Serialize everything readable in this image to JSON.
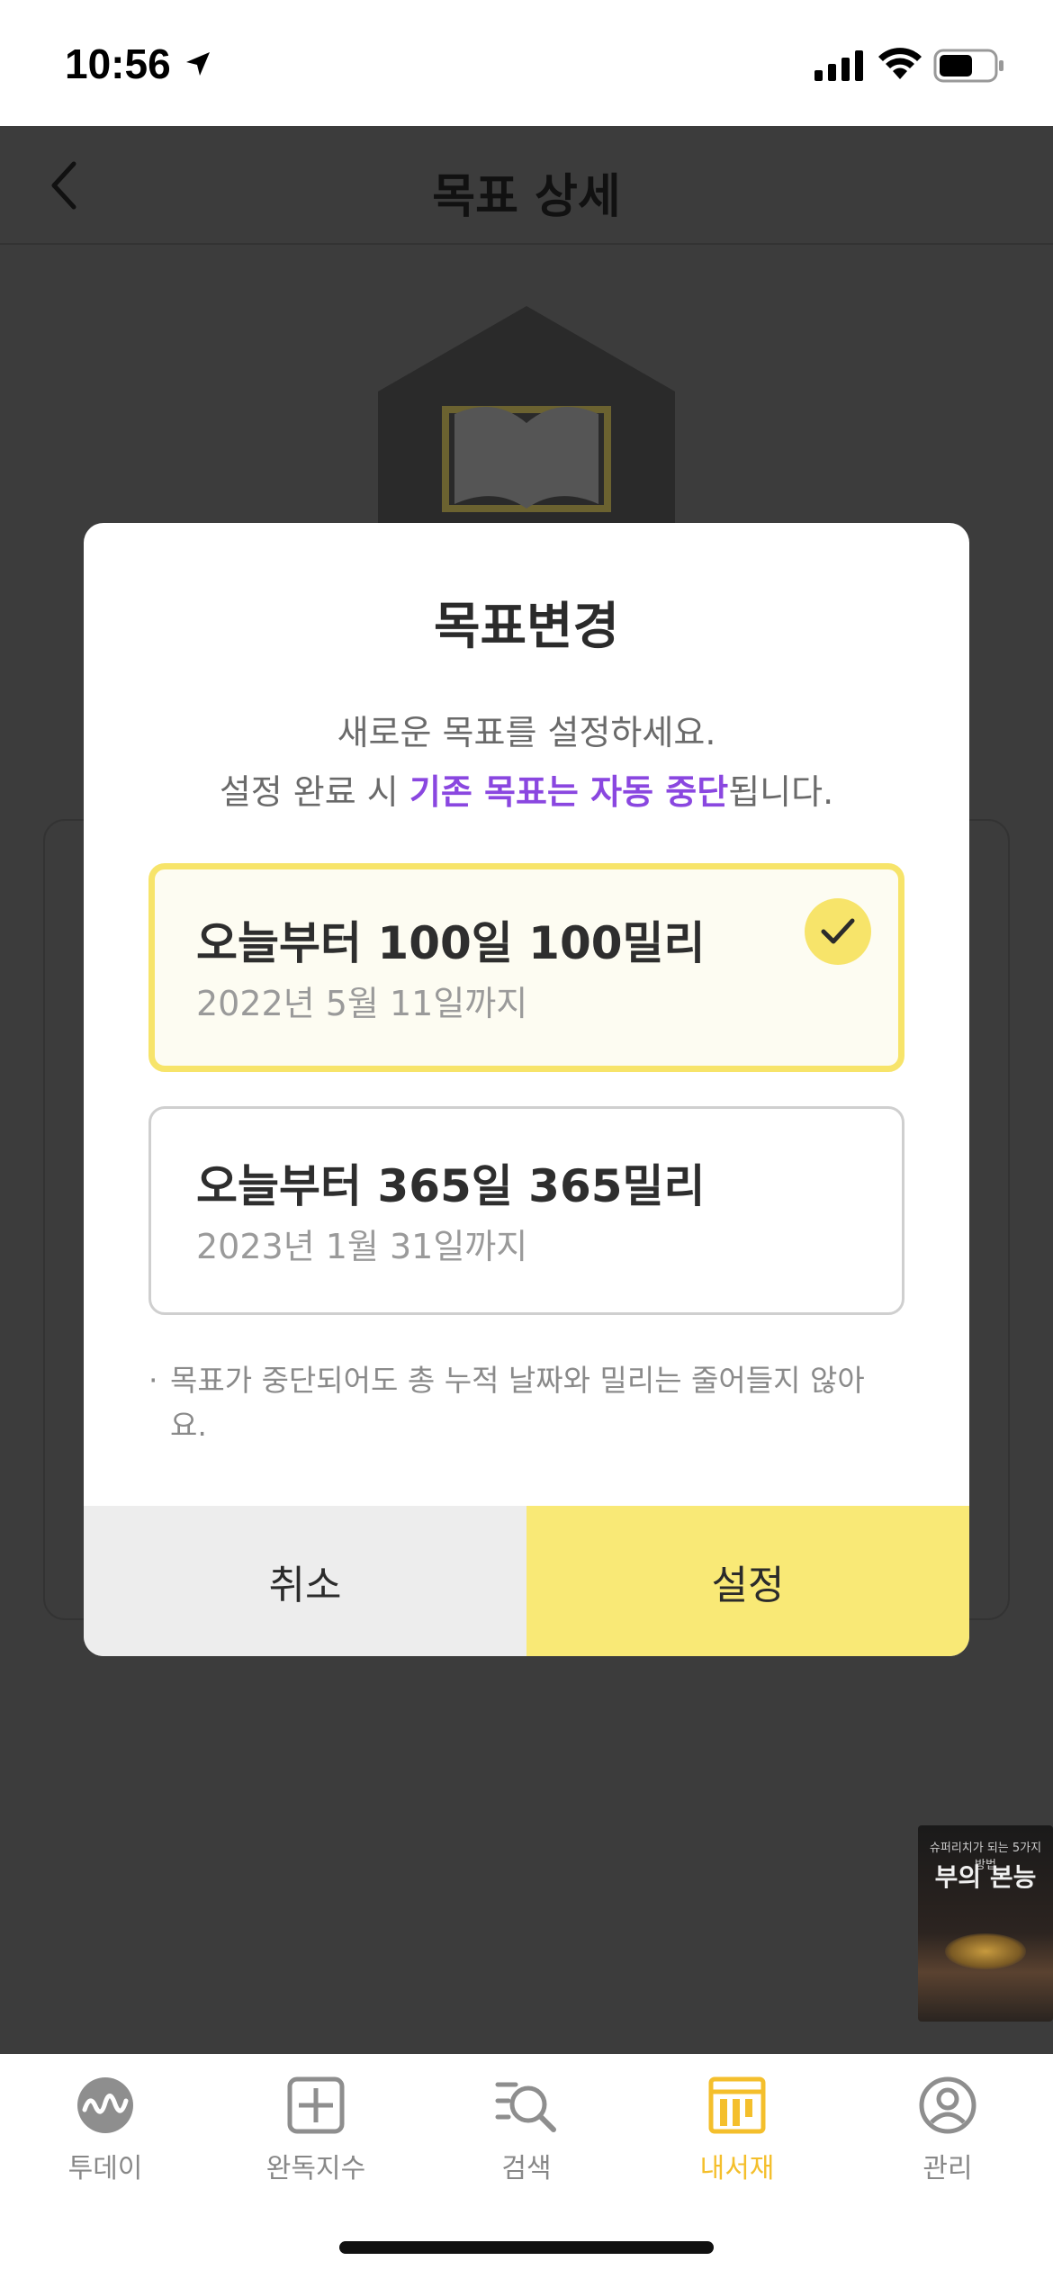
{
  "status_bar": {
    "time": "10:56",
    "icons": [
      "location-arrow-icon",
      "signal-icon",
      "wifi-icon",
      "battery-icon"
    ]
  },
  "header": {
    "title": "목표 상세",
    "back_icon": "chevron-left-icon"
  },
  "modal": {
    "title": "목표변경",
    "desc_line1": "새로운 목표를 설정하세요.",
    "desc_line2_prefix": "설정 완료 시 ",
    "desc_line2_highlight": "기존 목표는 자동 중단",
    "desc_line2_suffix": "됩니다.",
    "options": [
      {
        "title": "오늘부터 100일 100밀리",
        "subtitle": "2022년 5월 11일까지",
        "selected": true
      },
      {
        "title": "오늘부터 365일 365밀리",
        "subtitle": "2023년 1월 31일까지",
        "selected": false
      }
    ],
    "note_bullet": "·",
    "note": "목표가 중단되어도 총 누적 날짜와 밀리는 줄어들지 않아요.",
    "cancel_label": "취소",
    "confirm_label": "설정"
  },
  "floating_book": {
    "subtitle": "슈퍼리치가 되는 5가지 방법",
    "title": "부의 본능"
  },
  "tab_bar": {
    "items": [
      {
        "label": "투데이",
        "icon": "today-wave-icon",
        "active": false
      },
      {
        "label": "완독지수",
        "icon": "plus-square-icon",
        "active": false
      },
      {
        "label": "검색",
        "icon": "search-list-icon",
        "active": false
      },
      {
        "label": "내서재",
        "icon": "bookshelf-icon",
        "active": true
      },
      {
        "label": "관리",
        "icon": "profile-icon",
        "active": false
      }
    ]
  },
  "colors": {
    "accent_yellow": "#f9e976",
    "active_tab": "#f4bf2c",
    "highlight_purple": "#8a47e0",
    "overlay": "#3c3c3c"
  }
}
